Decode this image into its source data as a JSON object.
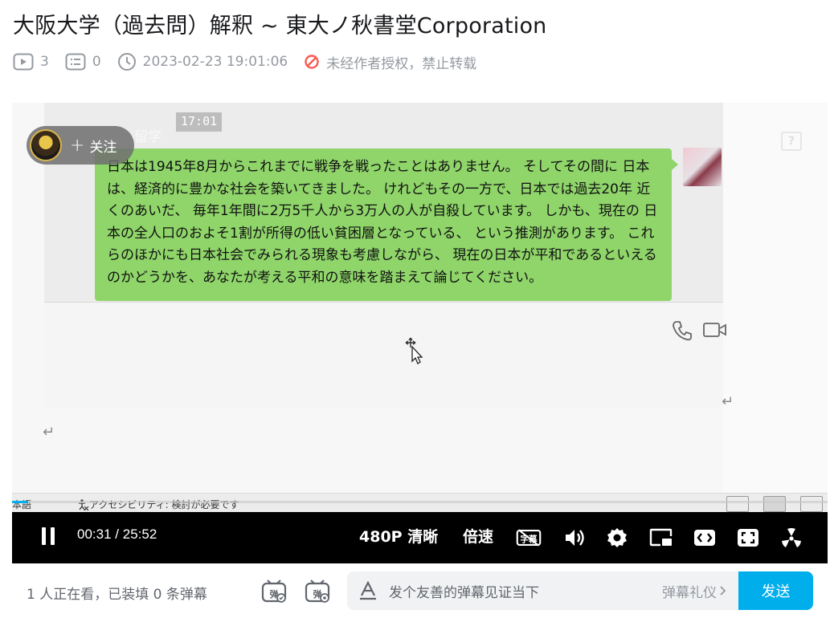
{
  "video": {
    "title": "大阪大学（過去問）解釈 ~ 東大ノ秋書堂Corporation",
    "play_count": "3",
    "danmaku_count": "0",
    "publish_time": "2023-02-23 19:01:06",
    "copyright_notice": "未经作者授权，禁止转载"
  },
  "player": {
    "follow_label": "关注",
    "uploader_ghost": "留学",
    "chat_timestamp": "17:01",
    "chat_message": "日本は1945年8月からこれまでに戦争を戦ったことはありません。 そしてその間に 日本は、経済的に豊かな社会を築いてきました。 けれどもその一方で、日本では過去20年 近くのあいだ、 毎年1年間に2万5千人から3万人の人が自殺しています。 しかも、現在の 日本の全人口のおよそ1割が所得の低い貧困層となっている、 という推測があります。 これらのほかにも日本社会でみられる現象も考慮しながら、 現在の日本が平和であるといえるのかどうかを、あなたが考える平和の意味を踏まえて論じてください。",
    "help_glyph": "?",
    "return_glyph": "↵",
    "statusbar_lang": "本語",
    "statusbar_accessibility": "アクセシビリティ: 検討が必要です",
    "current_time": "00:31",
    "time_separator": "/",
    "duration": "25:52",
    "progress_fraction": 0.02,
    "quality_label": "480P 清晰",
    "speed_label": "倍速"
  },
  "danmaku_bar": {
    "watching_text": "1 人正在看，已装填 0 条弹幕",
    "input_placeholder": "发个友善的弹幕见证当下",
    "etiquette_label": "弹幕礼仪",
    "send_label": "发送"
  },
  "icons": {
    "play_count": "play-count-icon",
    "danmaku_count": "danmaku-count-icon",
    "clock": "clock-icon",
    "forbidden": "forbidden-icon",
    "pause": "pause-icon",
    "subtitle": "subtitle-off-icon",
    "volume": "volume-icon",
    "settings": "gear-icon",
    "pip": "picture-in-picture-icon",
    "widescreen": "widescreen-icon",
    "web_fullscreen": "web-fullscreen-icon",
    "fullscreen": "fullscreen-icon"
  },
  "colors": {
    "accent": "#00aeec",
    "bubble": "#8fd56a",
    "warning": "#f85a54",
    "meta_text": "#9499a0"
  }
}
